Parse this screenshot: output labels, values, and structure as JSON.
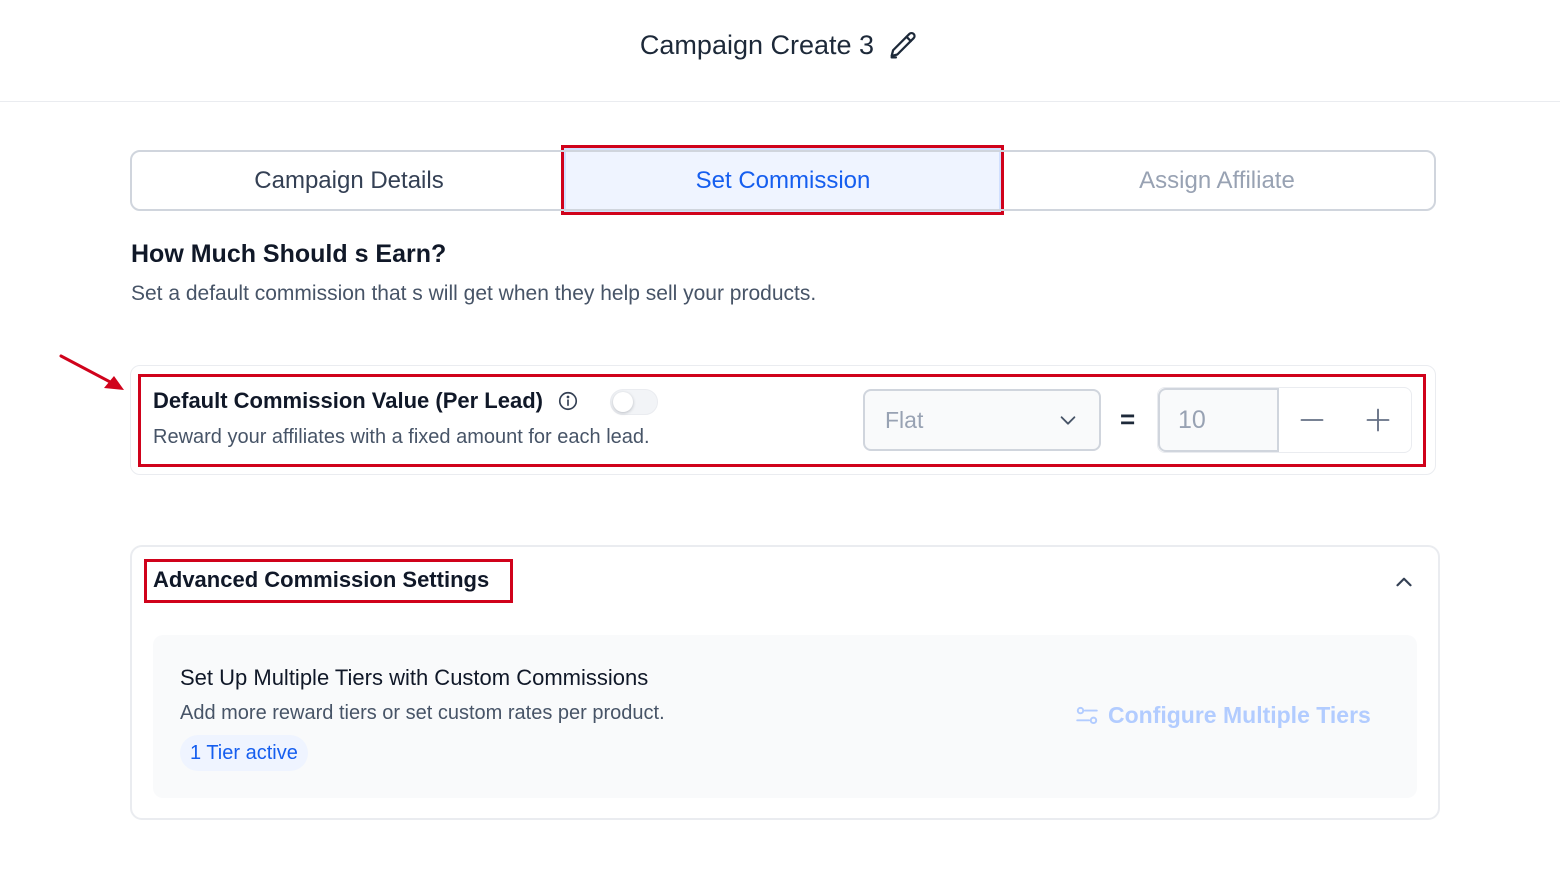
{
  "header": {
    "title": "Campaign Create 3",
    "edit_icon": "pencil-icon"
  },
  "tabs": [
    {
      "label": "Campaign Details",
      "state": "default"
    },
    {
      "label": "Set Commission",
      "state": "active"
    },
    {
      "label": "Assign Affiliate",
      "state": "disabled"
    }
  ],
  "section": {
    "title": "How Much Should s Earn?",
    "description": "Set a default commission that s will get when they help sell your products."
  },
  "default_commission": {
    "title": "Default Commission Value (Per Lead)",
    "description": "Reward your affiliates with a fixed amount for each lead.",
    "toggle_on": false,
    "type_value": "Flat",
    "equals": "=",
    "amount_value": "10"
  },
  "advanced": {
    "title": "Advanced Commission Settings",
    "tiers_title": "Set Up Multiple Tiers with Custom Commissions",
    "tiers_description": "Add more reward tiers or set custom rates per product.",
    "tier_badge": "1 Tier active",
    "configure_label": "Configure Multiple Tiers"
  },
  "colors": {
    "accent": "#155eef",
    "highlight": "#d0021b",
    "disabled_text": "#98a2b3"
  }
}
